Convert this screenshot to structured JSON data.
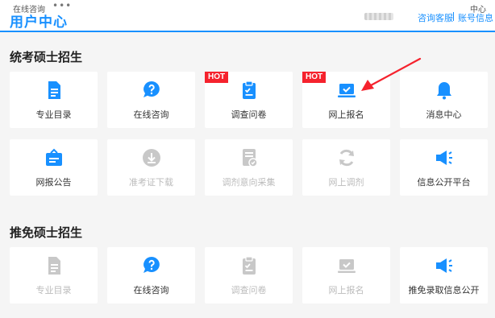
{
  "header": {
    "top_small_text": "在线咨询",
    "dots": "•••",
    "title": "用户中心",
    "top_right_small": "中心",
    "links": [
      "咨询客服",
      "账号信息"
    ]
  },
  "sections": [
    {
      "title": "统考硕士招生",
      "rows": [
        [
          {
            "label": "专业目录",
            "icon": "list-document-icon",
            "enabled": true
          },
          {
            "label": "在线咨询",
            "icon": "question-bubble-icon",
            "enabled": true
          },
          {
            "label": "调查问卷",
            "icon": "clipboard-icon",
            "enabled": true,
            "badge": "HOT"
          },
          {
            "label": "网上报名",
            "icon": "laptop-check-icon",
            "enabled": true,
            "badge": "HOT"
          },
          {
            "label": "消息中心",
            "icon": "bell-icon",
            "enabled": true
          }
        ],
        [
          {
            "label": "网报公告",
            "icon": "announcement-board-icon",
            "enabled": true
          },
          {
            "label": "准考证下载",
            "icon": "download-icon",
            "enabled": false
          },
          {
            "label": "调剂意向采集",
            "icon": "intent-form-icon",
            "enabled": false
          },
          {
            "label": "网上调剂",
            "icon": "refresh-icon",
            "enabled": false
          },
          {
            "label": "信息公开平台",
            "icon": "megaphone-icon",
            "enabled": true
          }
        ]
      ]
    },
    {
      "title": "推免硕士招生",
      "rows": [
        [
          {
            "label": "专业目录",
            "icon": "list-document-icon",
            "enabled": false
          },
          {
            "label": "在线咨询",
            "icon": "question-bubble-icon",
            "enabled": true
          },
          {
            "label": "调查问卷",
            "icon": "clipboard-icon",
            "enabled": false
          },
          {
            "label": "网上报名",
            "icon": "laptop-check-icon",
            "enabled": false
          },
          {
            "label": "推免录取信息公开",
            "icon": "megaphone-icon",
            "enabled": true
          }
        ]
      ]
    }
  ],
  "colors": {
    "accent": "#1890ff",
    "disabled_icon": "#c8c8c8",
    "hot_badge": "#f5222d",
    "annotation_arrow": "#f5222d"
  }
}
